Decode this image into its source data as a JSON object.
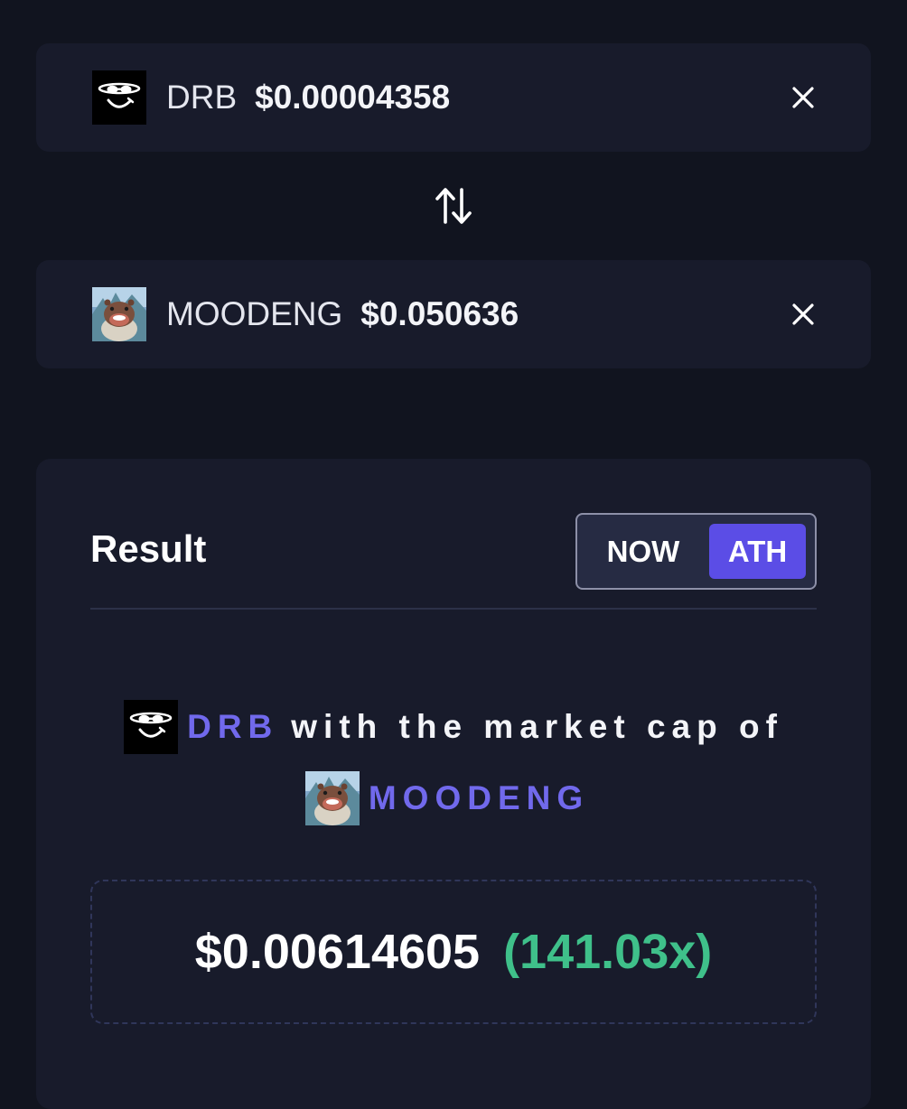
{
  "from_token": {
    "symbol": "DRB",
    "price": "$0.00004358",
    "logo_icon": "drb-smiley-logo-icon"
  },
  "to_token": {
    "symbol": "MOODENG",
    "price": "$0.050636",
    "logo_icon": "moodeng-hippo-logo-icon"
  },
  "swap_icon": "swap-arrows-icon",
  "remove_icon": "close-icon",
  "result": {
    "title": "Result",
    "toggle": {
      "options": [
        "NOW",
        "ATH"
      ],
      "selected": "ATH"
    },
    "sentence": {
      "token_a": "DRB",
      "middle_text": "with the market cap of",
      "token_b": "MOODENG"
    },
    "value": "$0.00614605",
    "multiplier": "(141.03x)"
  },
  "colors": {
    "background": "#11141f",
    "card": "#181b2b",
    "accent_purple": "#5b4de6",
    "token_name_purple": "#7169ec",
    "gain_green": "#3fc08a"
  }
}
